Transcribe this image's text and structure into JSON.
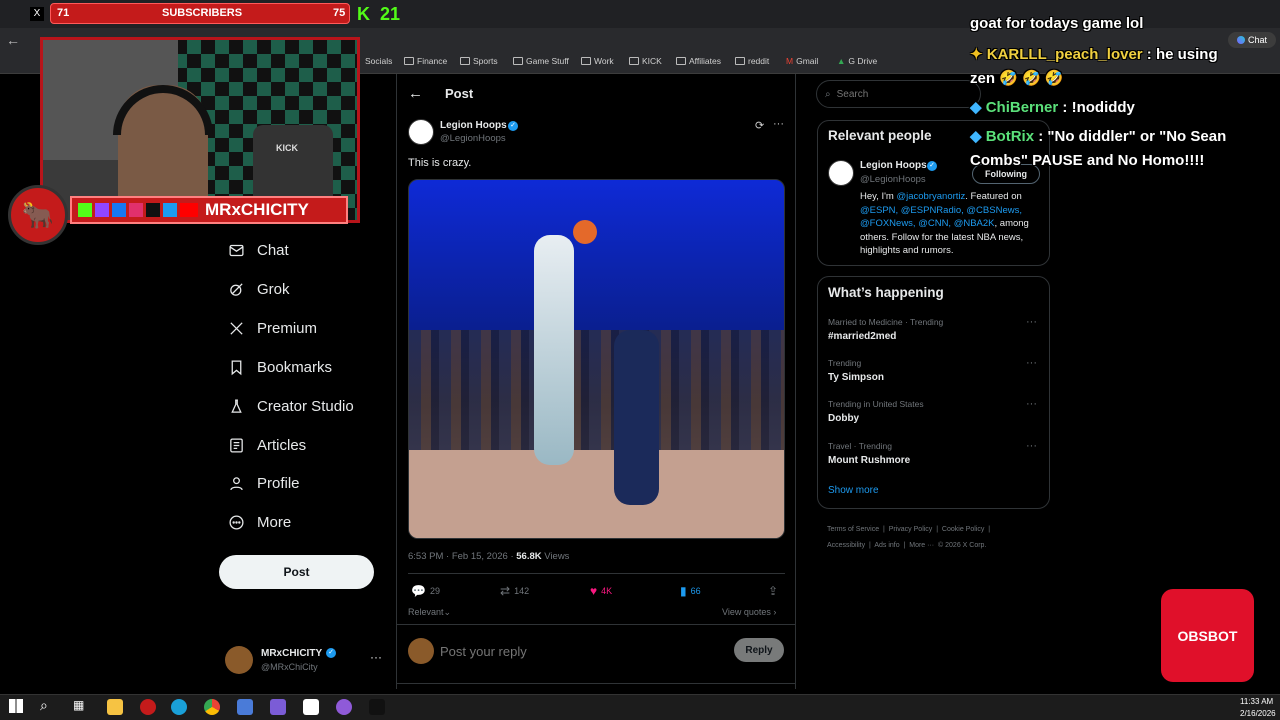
{
  "browser": {
    "tab_counts": {
      "left": "71",
      "right": "75"
    },
    "subscribers_label": "SUBSCRIBERS",
    "kick_count": "21",
    "chat_button": "Chat",
    "bookmarks": [
      "Socials",
      "Finance",
      "Sports",
      "Game Stuff",
      "Work",
      "KICK",
      "Affiliates",
      "reddit",
      "Gmail",
      "G Drive"
    ]
  },
  "streamer": {
    "name": "MRxCHICITY",
    "cam_sign": "KICK"
  },
  "sidebar": {
    "items": [
      {
        "label": "Chat",
        "icon": "mail-icon"
      },
      {
        "label": "Grok",
        "icon": "grok-icon"
      },
      {
        "label": "Premium",
        "icon": "x-icon"
      },
      {
        "label": "Bookmarks",
        "icon": "bookmark-icon"
      },
      {
        "label": "Creator Studio",
        "icon": "flask-icon"
      },
      {
        "label": "Articles",
        "icon": "article-icon"
      },
      {
        "label": "Profile",
        "icon": "person-icon"
      },
      {
        "label": "More",
        "icon": "more-circle-icon"
      }
    ],
    "post_button": "Post",
    "account": {
      "name": "MRxCHICITY",
      "handle": "@MRxChiCity"
    }
  },
  "post": {
    "header": "Post",
    "author": {
      "name": "Legion Hoops",
      "handle": "@LegionHoops"
    },
    "text": "This is crazy.",
    "timestamp": "6:53 PM · Feb 15, 2026 · ",
    "views_count": "56.8K",
    "views_label": " Views",
    "stats": {
      "replies": "29",
      "reposts": "142",
      "likes": "4K",
      "bookmarks": "66"
    },
    "relevant_label": "Relevant",
    "view_quotes": "View quotes",
    "reply_placeholder": "Post your reply",
    "reply_button": "Reply"
  },
  "right": {
    "search_placeholder": "Search",
    "relevant_people": {
      "title": "Relevant people",
      "name": "Legion Hoops",
      "handle": "@LegionHoops",
      "follow_button": "Following",
      "bio_pre": "Hey, I'm ",
      "bio_mention1": "@jacobryanortiz",
      "bio_mid": ". Featured on ",
      "bio_mentions": "@ESPN, @ESPNRadio, @CBSNews, @FOXNews, @CNN, @NBA2K",
      "bio_post": ", among others. Follow for the latest NBA news, highlights and rumors."
    },
    "whats_happening": {
      "title": "What’s happening",
      "trends": [
        {
          "context": "Married to Medicine · Trending",
          "name": "#married2med"
        },
        {
          "context": "Trending",
          "name": "Ty Simpson"
        },
        {
          "context": "Trending in United States",
          "name": "Dobby"
        },
        {
          "context": "Travel · Trending",
          "name": "Mount Rushmore"
        }
      ],
      "show_more": "Show more"
    },
    "footer": [
      "Terms of Service",
      "Privacy Policy",
      "Cookie Policy",
      "Accessibility",
      "Ads info",
      "More ···",
      "© 2026 X Corp."
    ]
  },
  "stream_chat": {
    "lines": [
      {
        "user": "",
        "text": "goat for todays game lol"
      },
      {
        "user": "KARLLL_peach_lover",
        "text": " : he using"
      },
      {
        "user": "",
        "text": "zen 🤣 🤣 🤣"
      },
      {
        "user": "ChiBerner",
        "text": " : !nodiddy"
      },
      {
        "user": "BotRix",
        "text": " : \"No diddler\" or \"No Sean"
      },
      {
        "user": "",
        "text": "Combs\" PAUSE and No Homo!!!!"
      }
    ]
  },
  "obsbot_label": "OBSBOT",
  "taskbar": {
    "time": "11:33 AM",
    "date": "2/16/2026"
  },
  "colors": {
    "accent": "#1d9bf0",
    "like": "#f91880",
    "overlay_red": "#c41b1b",
    "kick_green": "#53fc18"
  }
}
